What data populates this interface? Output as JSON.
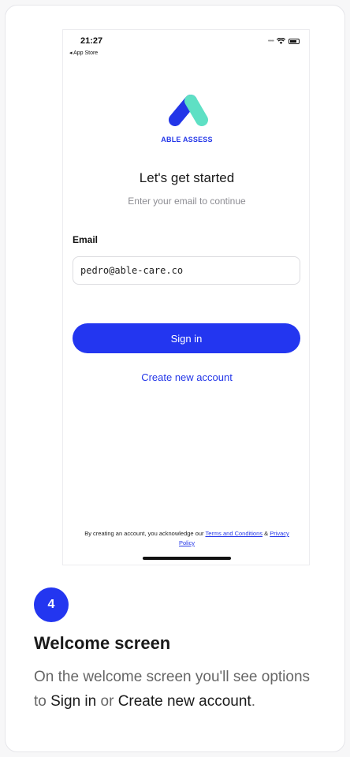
{
  "phone": {
    "status": {
      "time": "21:27",
      "back_label": "◂ App Store"
    },
    "brand": "ABLE ASSESS",
    "headline": "Let's get started",
    "subline": "Enter your email to continue",
    "email": {
      "label": "Email",
      "value": "pedro@able-care.co",
      "placeholder": ""
    },
    "signin_label": "Sign in",
    "create_account_label": "Create new account",
    "legal": {
      "prefix": "By creating an account, you acknowledge our ",
      "terms_label": "Terms and Conditions",
      "amp": " & ",
      "privacy_label": "Privacy Policy"
    }
  },
  "step": {
    "number": "4",
    "title": "Welcome screen",
    "desc_before": "On the welcome screen you'll see options to ",
    "desc_signin": "Sign in",
    "desc_or": " or ",
    "desc_create": "Create new account",
    "desc_end": "."
  },
  "colors": {
    "accent": "#2336f0",
    "logo_teal": "#5ee0c4",
    "logo_blue": "#2336e8"
  }
}
